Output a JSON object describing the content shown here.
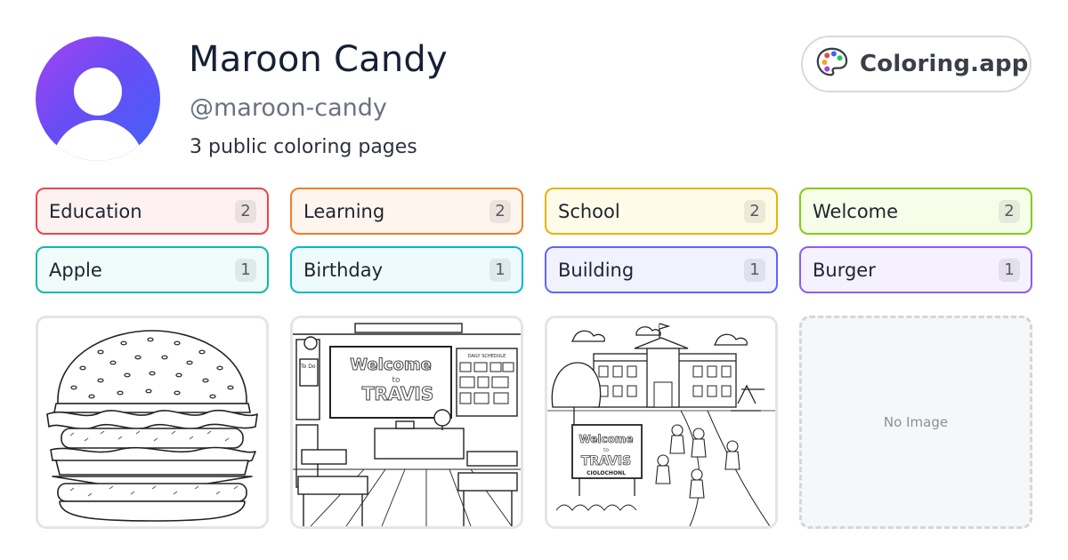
{
  "profile": {
    "name": "Maroon Candy",
    "handle": "@maroon-candy",
    "count_text": "3 public coloring pages"
  },
  "brand": {
    "label": "Coloring.app",
    "icon": "palette-icon"
  },
  "tags": [
    {
      "label": "Education",
      "count": "2",
      "border": "#e5484d",
      "bg": "#fdf1f1"
    },
    {
      "label": "Learning",
      "count": "2",
      "border": "#f07f2a",
      "bg": "#fef5ee"
    },
    {
      "label": "School",
      "count": "2",
      "border": "#eab308",
      "bg": "#fefbe8"
    },
    {
      "label": "Welcome",
      "count": "2",
      "border": "#84cc16",
      "bg": "#f6fde9"
    },
    {
      "label": "Apple",
      "count": "1",
      "border": "#14b8a6",
      "bg": "#effcfa"
    },
    {
      "label": "Birthday",
      "count": "1",
      "border": "#06b6d4",
      "bg": "#eefbfd"
    },
    {
      "label": "Building",
      "count": "1",
      "border": "#6366f1",
      "bg": "#f1f2fe"
    },
    {
      "label": "Burger",
      "count": "1",
      "border": "#8b5cf6",
      "bg": "#f5f1fe"
    }
  ],
  "cards": [
    {
      "kind": "burger"
    },
    {
      "kind": "classroom",
      "welcome": "Welcome",
      "to": "to",
      "travis": "TRAVIS",
      "todo": "To Do",
      "board_label": "DAILY SCHEDULE"
    },
    {
      "kind": "school",
      "welcome": "Welcome",
      "to": "to",
      "travis": "TRAVIS",
      "sign_bottom": "CIOLOCHONL"
    },
    {
      "kind": "empty",
      "text": "No Image"
    }
  ]
}
